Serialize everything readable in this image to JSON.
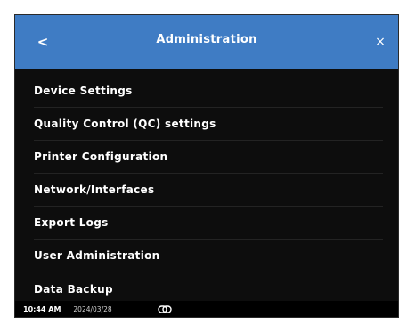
{
  "header": {
    "back_icon": "chevron-left-icon",
    "back_glyph": "<",
    "title": "Administration",
    "close_icon": "close-icon",
    "close_glyph": "×",
    "color": "#3f7cc4"
  },
  "menu": {
    "items": [
      {
        "label": "Device Settings"
      },
      {
        "label": "Quality Control (QC) settings"
      },
      {
        "label": "Printer Configuration"
      },
      {
        "label": "Network/Interfaces"
      },
      {
        "label": "Export Logs"
      },
      {
        "label": "User Administration"
      },
      {
        "label": "Data Backup"
      }
    ]
  },
  "status_bar": {
    "time": "10:44 AM",
    "date": "2024/03/28",
    "connection_icon": "link-icon"
  }
}
